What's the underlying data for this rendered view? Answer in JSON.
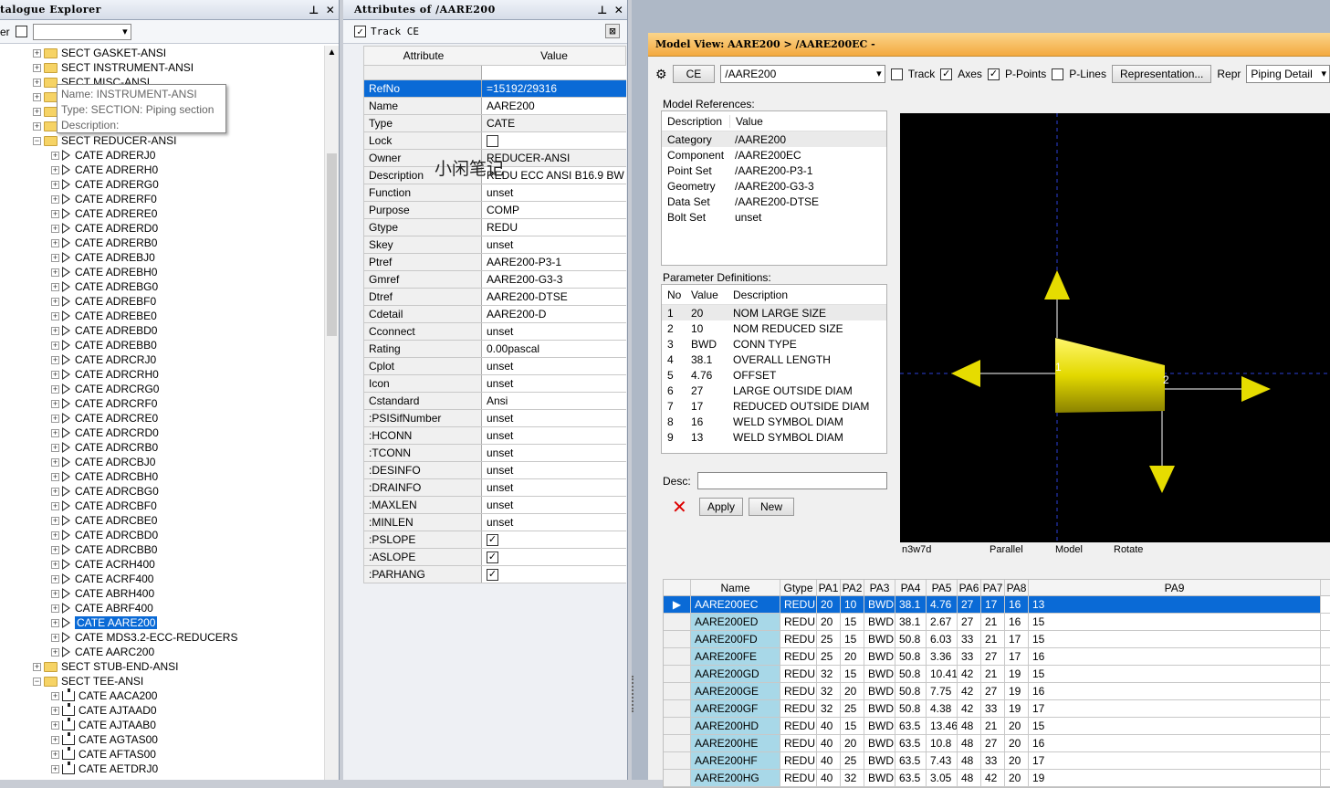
{
  "explorer": {
    "title": "talogue Explorer",
    "filter_label": "er",
    "pin": "ᵖ",
    "close": "✕",
    "items": [
      {
        "level": 1,
        "icon": "folder",
        "label": "SECT GASKET-ANSI"
      },
      {
        "level": 1,
        "icon": "folder",
        "label": "SECT INSTRUMENT-ANSI"
      },
      {
        "level": 1,
        "icon": "folder",
        "label": "SECT MISC-ANSI"
      },
      {
        "level": 1,
        "icon": "folder",
        "label": ""
      },
      {
        "level": 1,
        "icon": "folder",
        "label": ""
      },
      {
        "level": 1,
        "icon": "folder",
        "label": ""
      },
      {
        "level": 1,
        "icon": "folder",
        "label": "SECT REDUCER-ANSI",
        "open": true
      },
      {
        "level": 2,
        "icon": "tri",
        "label": "CATE ADRERJ0"
      },
      {
        "level": 2,
        "icon": "tri",
        "label": "CATE ADRERH0"
      },
      {
        "level": 2,
        "icon": "tri",
        "label": "CATE ADRERG0"
      },
      {
        "level": 2,
        "icon": "tri",
        "label": "CATE ADRERF0"
      },
      {
        "level": 2,
        "icon": "tri",
        "label": "CATE ADRERE0"
      },
      {
        "level": 2,
        "icon": "tri",
        "label": "CATE ADRERD0"
      },
      {
        "level": 2,
        "icon": "tri",
        "label": "CATE ADRERB0"
      },
      {
        "level": 2,
        "icon": "tri",
        "label": "CATE ADREBJ0"
      },
      {
        "level": 2,
        "icon": "tri",
        "label": "CATE ADREBH0"
      },
      {
        "level": 2,
        "icon": "tri",
        "label": "CATE ADREBG0"
      },
      {
        "level": 2,
        "icon": "tri",
        "label": "CATE ADREBF0"
      },
      {
        "level": 2,
        "icon": "tri",
        "label": "CATE ADREBE0"
      },
      {
        "level": 2,
        "icon": "tri",
        "label": "CATE ADREBD0"
      },
      {
        "level": 2,
        "icon": "tri",
        "label": "CATE ADREBB0"
      },
      {
        "level": 2,
        "icon": "tri",
        "label": "CATE ADRCRJ0"
      },
      {
        "level": 2,
        "icon": "tri",
        "label": "CATE ADRCRH0"
      },
      {
        "level": 2,
        "icon": "tri",
        "label": "CATE ADRCRG0"
      },
      {
        "level": 2,
        "icon": "tri",
        "label": "CATE ADRCRF0"
      },
      {
        "level": 2,
        "icon": "tri",
        "label": "CATE ADRCRE0"
      },
      {
        "level": 2,
        "icon": "tri",
        "label": "CATE ADRCRD0"
      },
      {
        "level": 2,
        "icon": "tri",
        "label": "CATE ADRCRB0"
      },
      {
        "level": 2,
        "icon": "tri",
        "label": "CATE ADRCBJ0"
      },
      {
        "level": 2,
        "icon": "tri",
        "label": "CATE ADRCBH0"
      },
      {
        "level": 2,
        "icon": "tri",
        "label": "CATE ADRCBG0"
      },
      {
        "level": 2,
        "icon": "tri",
        "label": "CATE ADRCBF0"
      },
      {
        "level": 2,
        "icon": "tri",
        "label": "CATE ADRCBE0"
      },
      {
        "level": 2,
        "icon": "tri",
        "label": "CATE ADRCBD0"
      },
      {
        "level": 2,
        "icon": "tri",
        "label": "CATE ADRCBB0"
      },
      {
        "level": 2,
        "icon": "tri",
        "label": "CATE ACRH400"
      },
      {
        "level": 2,
        "icon": "tri",
        "label": "CATE ACRF400"
      },
      {
        "level": 2,
        "icon": "tri",
        "label": "CATE ABRH400"
      },
      {
        "level": 2,
        "icon": "tri",
        "label": "CATE ABRF400"
      },
      {
        "level": 2,
        "icon": "tri",
        "label": "CATE AARE200",
        "selected": true
      },
      {
        "level": 2,
        "icon": "tri",
        "label": "CATE MDS3.2-ECC-REDUCERS"
      },
      {
        "level": 2,
        "icon": "tri",
        "label": "CATE AARC200"
      },
      {
        "level": 1,
        "icon": "folder",
        "label": "SECT STUB-END-ANSI"
      },
      {
        "level": 1,
        "icon": "folder",
        "label": "SECT TEE-ANSI",
        "open": true
      },
      {
        "level": 2,
        "icon": "pipe",
        "label": "CATE AACA200"
      },
      {
        "level": 2,
        "icon": "pipe",
        "label": "CATE AJTAAD0"
      },
      {
        "level": 2,
        "icon": "pipe",
        "label": "CATE AJTAAB0"
      },
      {
        "level": 2,
        "icon": "pipe",
        "label": "CATE AGTAS00"
      },
      {
        "level": 2,
        "icon": "pipe",
        "label": "CATE AFTAS00"
      },
      {
        "level": 2,
        "icon": "pipe",
        "label": "CATE AETDRJ0"
      }
    ],
    "tooltip": {
      "name": "Name: INSTRUMENT-ANSI",
      "type": "Type: SECTION: Piping section",
      "desc": "Description:"
    }
  },
  "attributes": {
    "title": "Attributes of /AARE200",
    "track": "Track CE",
    "head_attr": "Attribute",
    "head_val": "Value",
    "watermark": "小闲笔记",
    "rows": [
      {
        "k": "RefNo",
        "v": "=15192/29316",
        "hi": true
      },
      {
        "k": "Name",
        "v": "AARE200"
      },
      {
        "k": "Type",
        "v": "CATE",
        "ro": true
      },
      {
        "k": "Lock",
        "v": "",
        "cb": false
      },
      {
        "k": "Owner",
        "v": "REDUCER-ANSI",
        "ro": true
      },
      {
        "k": "Description",
        "v": "REDU ECC ANSI B16.9 BW"
      },
      {
        "k": "Function",
        "v": "unset"
      },
      {
        "k": "Purpose",
        "v": "COMP"
      },
      {
        "k": "Gtype",
        "v": "REDU"
      },
      {
        "k": "Skey",
        "v": "unset"
      },
      {
        "k": "Ptref",
        "v": "AARE200-P3-1"
      },
      {
        "k": "Gmref",
        "v": "AARE200-G3-3"
      },
      {
        "k": "Dtref",
        "v": "AARE200-DTSE"
      },
      {
        "k": "Cdetail",
        "v": "AARE200-D"
      },
      {
        "k": "Cconnect",
        "v": "unset"
      },
      {
        "k": "Rating",
        "v": "0.00pascal"
      },
      {
        "k": "Cplot",
        "v": "unset"
      },
      {
        "k": "Icon",
        "v": "unset"
      },
      {
        "k": "Cstandard",
        "v": "Ansi"
      },
      {
        "k": ":PSISifNumber",
        "v": "unset"
      },
      {
        "k": ":HCONN",
        "v": "unset"
      },
      {
        "k": ":TCONN",
        "v": "unset"
      },
      {
        "k": ":DESINFO",
        "v": "unset"
      },
      {
        "k": ":DRAINFO",
        "v": "unset"
      },
      {
        "k": ":MAXLEN",
        "v": "unset"
      },
      {
        "k": ":MINLEN",
        "v": "unset"
      },
      {
        "k": ":PSLOPE",
        "v": "",
        "cb": true
      },
      {
        "k": ":ASLOPE",
        "v": "",
        "cb": true
      },
      {
        "k": ":PARHANG",
        "v": "",
        "cb": true
      }
    ]
  },
  "modelview": {
    "title": "Model View: AARE200 > /AARE200EC -",
    "ce": "CE",
    "path": "/AARE200",
    "track": "Track",
    "axes": "Axes",
    "ppoints": "P-Points",
    "plines": "P-Lines",
    "rep_btn": "Representation...",
    "repr": "Repr",
    "repr_val": "Piping Detail",
    "refs_label": "Model References:",
    "refs_head": [
      "Description",
      "Value"
    ],
    "refs": [
      [
        "Category",
        "/AARE200"
      ],
      [
        "Component",
        "/AARE200EC"
      ],
      [
        "Point Set",
        "/AARE200-P3-1"
      ],
      [
        "Geometry",
        "/AARE200-G3-3"
      ],
      [
        "Data Set",
        "/AARE200-DTSE"
      ],
      [
        "Bolt Set",
        "unset"
      ]
    ],
    "params_label": "Parameter Definitions:",
    "params_head": [
      "No",
      "Value",
      "Description"
    ],
    "params": [
      [
        "1",
        "20",
        "NOM LARGE SIZE"
      ],
      [
        "2",
        "10",
        "NOM REDUCED SIZE"
      ],
      [
        "3",
        "BWD",
        "CONN TYPE"
      ],
      [
        "4",
        "38.1",
        "OVERALL LENGTH"
      ],
      [
        "5",
        "4.76",
        "OFFSET"
      ],
      [
        "6",
        "27",
        "LARGE OUTSIDE DIAM"
      ],
      [
        "7",
        "17",
        "REDUCED OUTSIDE DIAM"
      ],
      [
        "8",
        "16",
        "WELD SYMBOL DIAM"
      ],
      [
        "9",
        "13",
        "WELD SYMBOL DIAM"
      ]
    ],
    "desc_label": "Desc:",
    "apply": "Apply",
    "new": "New",
    "view_labels": [
      "n3w7d",
      "Parallel",
      "Model",
      "Rotate"
    ],
    "point_labels": [
      "1",
      "2"
    ],
    "grid_head": [
      "Name",
      "Gtype",
      "PA1",
      "PA2",
      "PA3",
      "PA4",
      "PA5",
      "PA6",
      "PA7",
      "PA8",
      "PA9"
    ],
    "grid": [
      [
        "AARE200EC",
        "REDU",
        "20",
        "10",
        "BWD",
        "38.1",
        "4.76",
        "27",
        "17",
        "16",
        "13"
      ],
      [
        "AARE200ED",
        "REDU",
        "20",
        "15",
        "BWD",
        "38.1",
        "2.67",
        "27",
        "21",
        "16",
        "15"
      ],
      [
        "AARE200FD",
        "REDU",
        "25",
        "15",
        "BWD",
        "50.8",
        "6.03",
        "33",
        "21",
        "17",
        "15"
      ],
      [
        "AARE200FE",
        "REDU",
        "25",
        "20",
        "BWD",
        "50.8",
        "3.36",
        "33",
        "27",
        "17",
        "16"
      ],
      [
        "AARE200GD",
        "REDU",
        "32",
        "15",
        "BWD",
        "50.8",
        "10.41",
        "42",
        "21",
        "19",
        "15"
      ],
      [
        "AARE200GE",
        "REDU",
        "32",
        "20",
        "BWD",
        "50.8",
        "7.75",
        "42",
        "27",
        "19",
        "16"
      ],
      [
        "AARE200GF",
        "REDU",
        "32",
        "25",
        "BWD",
        "50.8",
        "4.38",
        "42",
        "33",
        "19",
        "17"
      ],
      [
        "AARE200HD",
        "REDU",
        "40",
        "15",
        "BWD",
        "63.5",
        "13.46",
        "48",
        "21",
        "20",
        "15"
      ],
      [
        "AARE200HE",
        "REDU",
        "40",
        "20",
        "BWD",
        "63.5",
        "10.8",
        "48",
        "27",
        "20",
        "16"
      ],
      [
        "AARE200HF",
        "REDU",
        "40",
        "25",
        "BWD",
        "63.5",
        "7.43",
        "48",
        "33",
        "20",
        "17"
      ],
      [
        "AARE200HG",
        "REDU",
        "40",
        "32",
        "BWD",
        "63.5",
        "3.05",
        "48",
        "42",
        "20",
        "19"
      ]
    ]
  }
}
